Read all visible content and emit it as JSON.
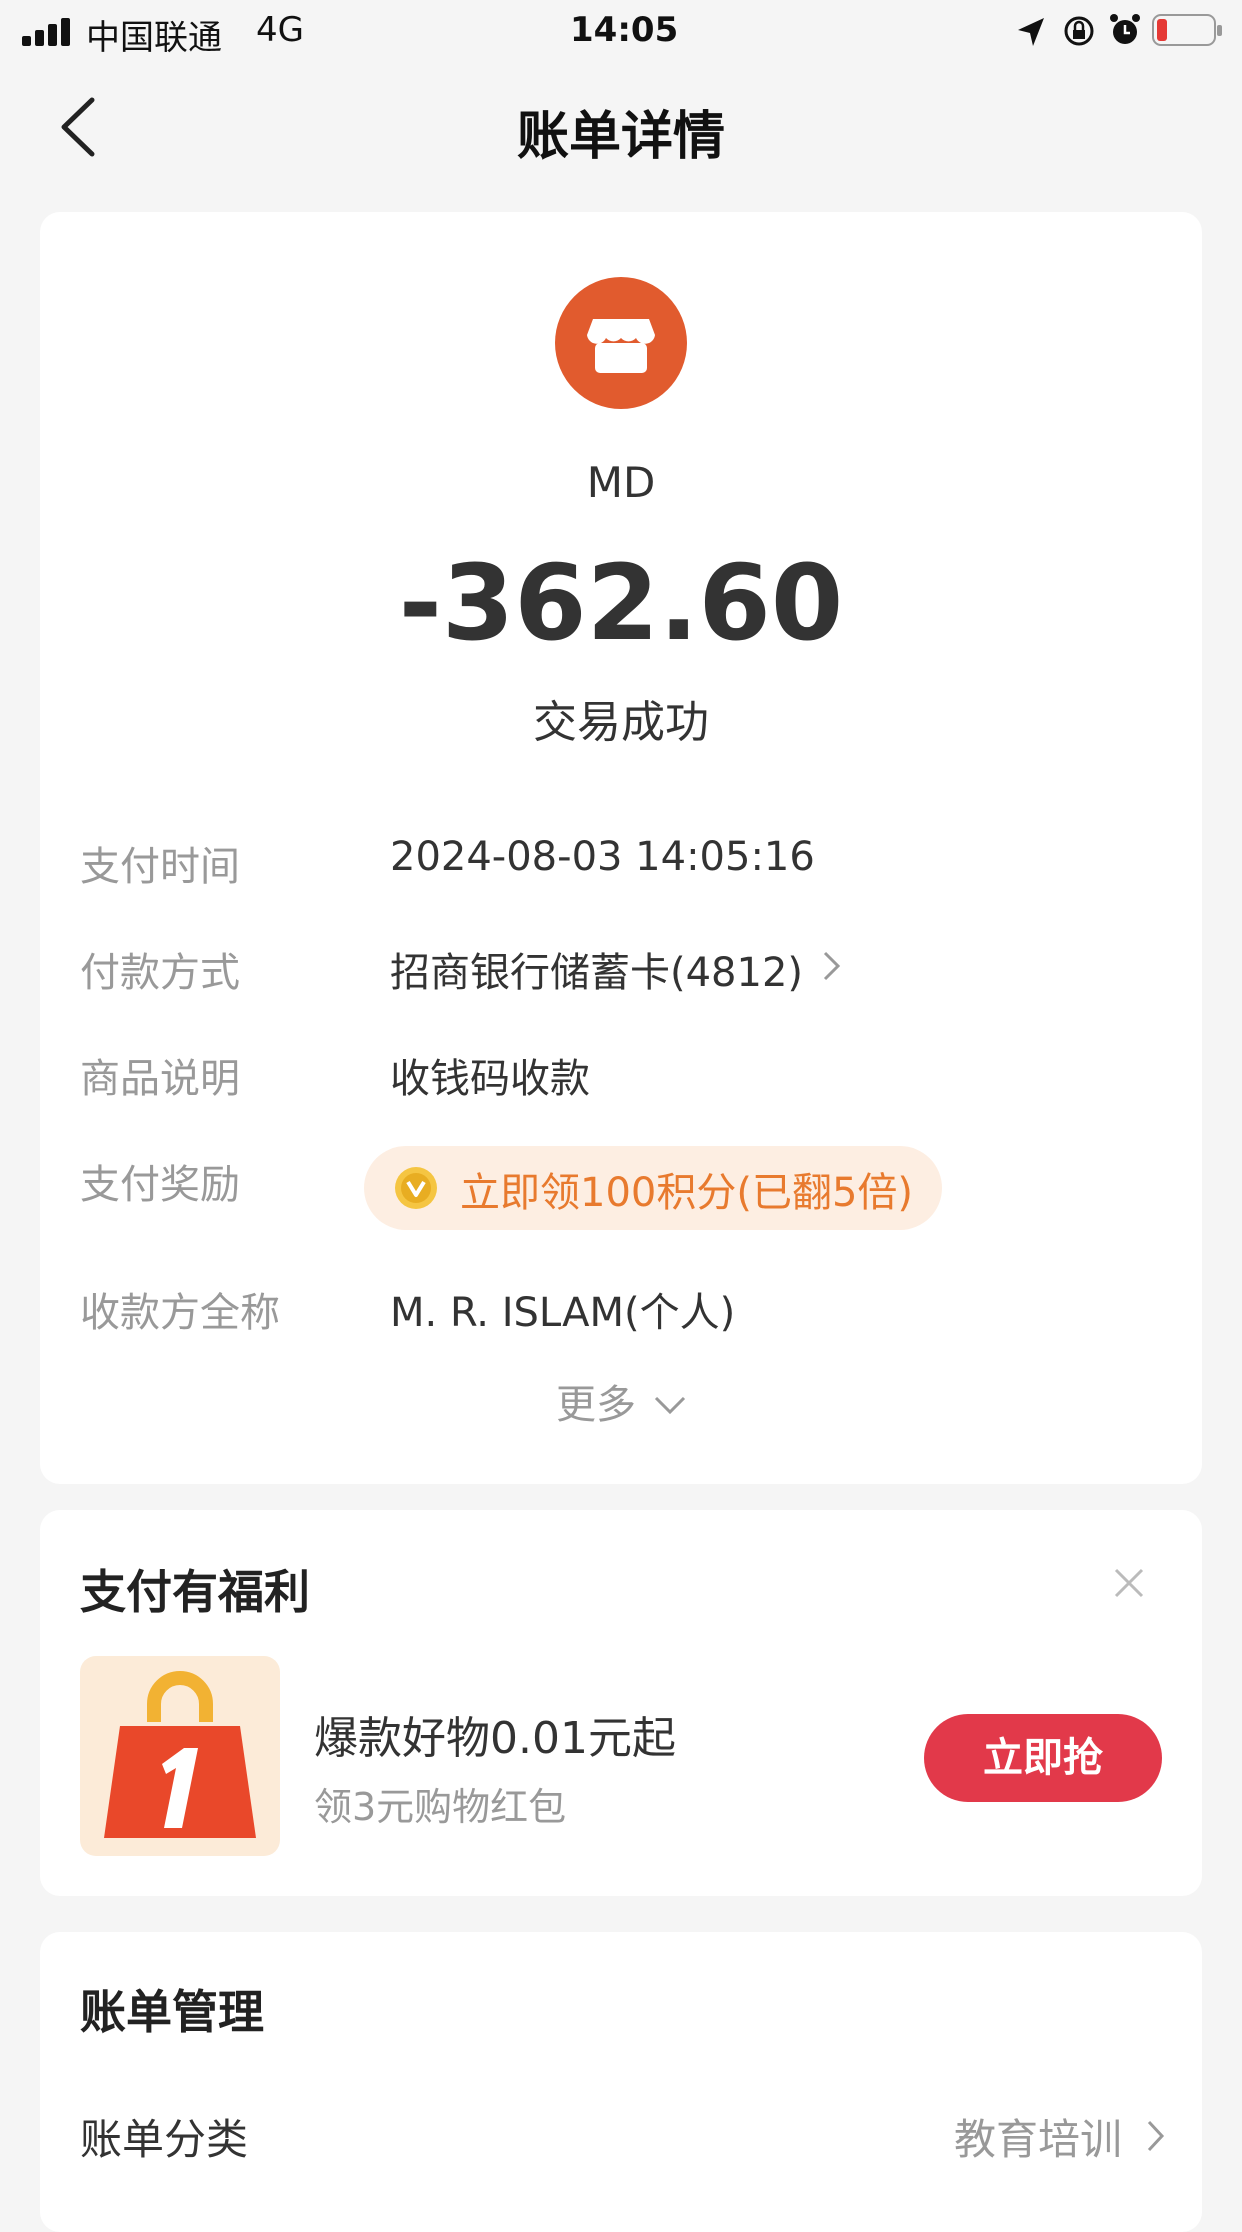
{
  "status_bar": {
    "carrier": "中国联通",
    "network": "4G",
    "time": "14:05"
  },
  "nav": {
    "title": "账单详情"
  },
  "transaction": {
    "merchant_name": "MD",
    "amount": "-362.60",
    "status": "交易成功",
    "merchant_icon": "store-icon",
    "accent_color": "#e15b2e"
  },
  "details": {
    "pay_time_label": "支付时间",
    "pay_time_value": "2024-08-03 14:05:16",
    "pay_method_label": "付款方式",
    "pay_method_value": "招商银行储蓄卡(4812)",
    "item_label": "商品说明",
    "item_value": "收钱码收款",
    "reward_label": "支付奖励",
    "reward_value": "立即领100积分(已翻5倍)",
    "payee_label": "收款方全称",
    "payee_value": "M. R. ISLAM(个人)",
    "more_label": "更多"
  },
  "benefit": {
    "title": "支付有福利",
    "promo_title": "爆款好物0.01元起",
    "promo_subtitle": "领3元购物红包",
    "button_label": "立即抢",
    "button_color": "#e2394a"
  },
  "bill_management": {
    "title": "账单管理",
    "category_label": "账单分类",
    "category_value": "教育培训"
  }
}
